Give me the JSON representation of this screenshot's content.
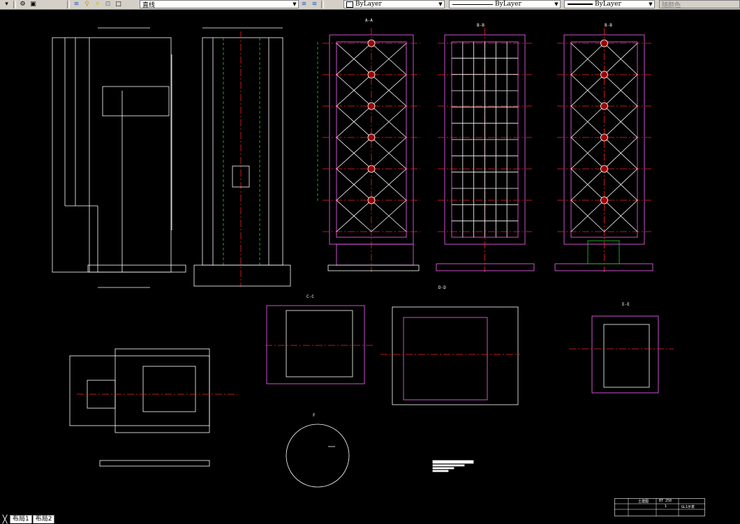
{
  "toolbar": {
    "left_icons": [
      "layers-icon",
      "bulb-icon",
      "sun-icon",
      "lock-icon",
      "square-icon"
    ],
    "layer_name": "直线",
    "match_icons": [
      "layer-match-icon",
      "layer-previous-icon"
    ],
    "color_combo": {
      "value": "ByLayer"
    },
    "linetype_combo": {
      "value": "ByLayer"
    },
    "lineweight_combo": {
      "value": "ByLayer"
    },
    "plotstyle_combo": {
      "value": "随颜色"
    }
  },
  "drawing": {
    "background": "#000000",
    "section_labels": {
      "view_a": "A-A",
      "view_b": "B-B",
      "view_c": "B-B",
      "cc": "C-C",
      "dd": "D-D",
      "ee": "E-E",
      "ff": "F"
    },
    "title_block": {
      "r1": "土建图",
      "r2": "BT 250",
      "r3": "1",
      "r4": "GL1示意"
    }
  },
  "tabs": {
    "layout1": "布局1",
    "layout2": "布局2"
  },
  "colors": {
    "line_white": "#ffffff",
    "center_red": "#ff2020",
    "wall_magenta": "#ff66ff",
    "hidden_green": "#22cc22",
    "toolbar_gray": "#d4d0c8"
  }
}
